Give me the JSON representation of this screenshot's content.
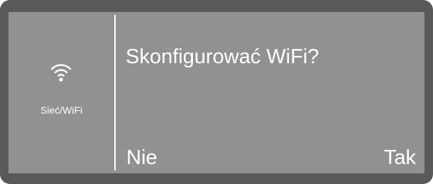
{
  "sidebar": {
    "icon": "wifi-icon",
    "label": "Sieć/WiFi"
  },
  "dialog": {
    "prompt": "Skonfigurować WiFi?",
    "no_label": "Nie",
    "yes_label": "Tak"
  },
  "colors": {
    "bezel": "#58595b",
    "screen": "#909193",
    "text": "#ffffff"
  }
}
